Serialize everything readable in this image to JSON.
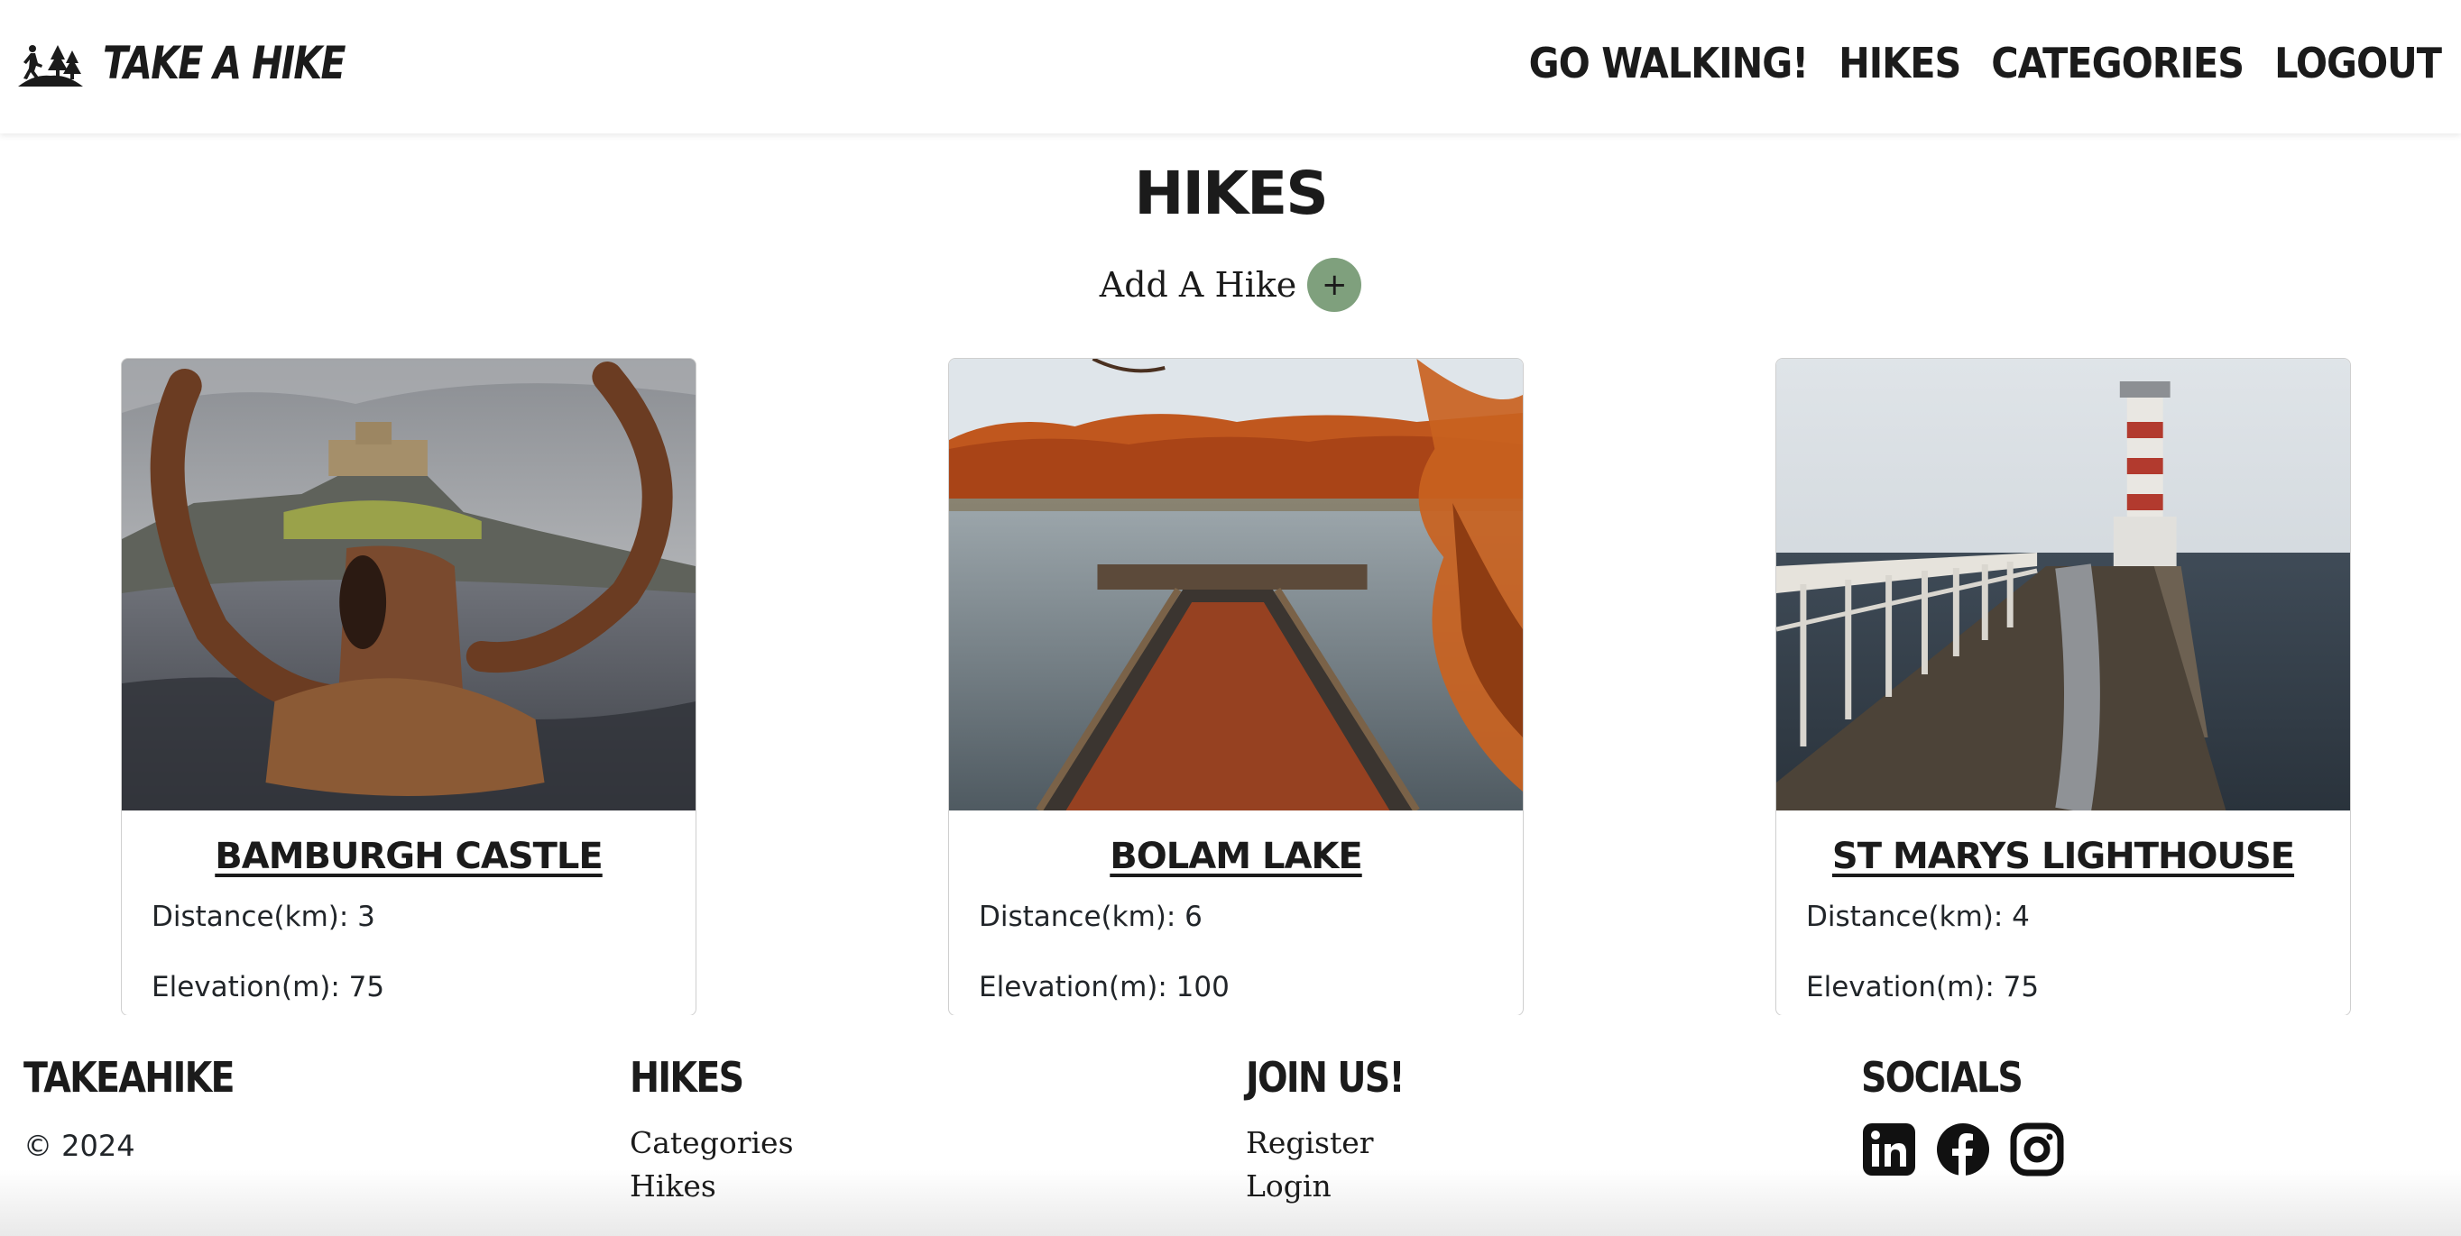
{
  "navbar": {
    "brand": "TAKE A HIKE",
    "brand_icon": "hikers-trees-icon",
    "links": [
      "GO WALKING!",
      "HIKES",
      "CATEGORIES",
      "LOGOUT"
    ]
  },
  "main": {
    "title": "HIKES",
    "add_hike_label": "Add A Hike",
    "add_hike_icon": "+"
  },
  "hikes": [
    {
      "name": "BAMBURGH CASTLE",
      "distance": "Distance(km): 3",
      "elevation": "Elevation(m): 75",
      "image": "castle-iron-ring-photo"
    },
    {
      "name": "BOLAM LAKE",
      "distance": "Distance(km): 6",
      "elevation": "Elevation(m): 100",
      "image": "lake-jetty-autumn-photo"
    },
    {
      "name": "ST MARYS LIGHTHOUSE",
      "distance": "Distance(km): 4",
      "elevation": "Elevation(m): 75",
      "image": "lighthouse-pier-photo"
    }
  ],
  "footer": {
    "brand_heading": "TAKEAHIKE",
    "copyright": "© 2024",
    "hikes_heading": "HIKES",
    "hikes_links": [
      "Categories",
      "Hikes"
    ],
    "join_heading": "JOIN US!",
    "join_links": [
      "Register",
      "Login"
    ],
    "socials_heading": "SOCIALS",
    "social_icons": [
      "linkedin-icon",
      "facebook-icon",
      "instagram-icon"
    ]
  },
  "colors": {
    "add_button": "#7fa07d",
    "text": "#1b1b1b",
    "card_border": "#cfcfcf"
  }
}
